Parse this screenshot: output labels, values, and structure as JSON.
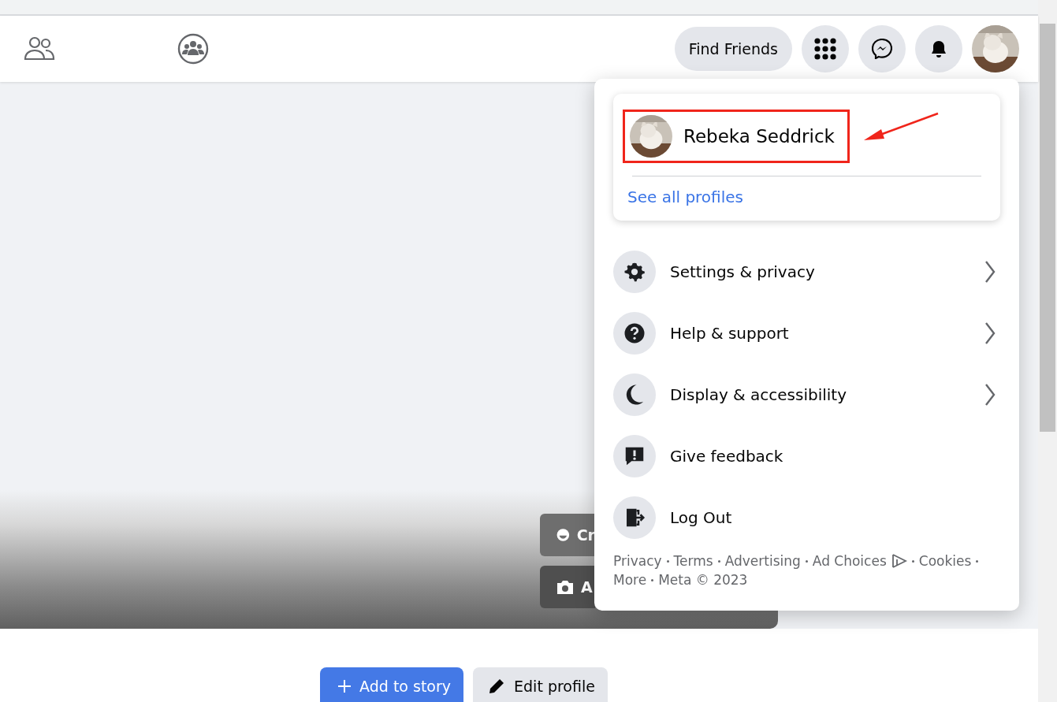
{
  "navbar": {
    "find_friends": "Find Friends"
  },
  "cover": {
    "buttons": [
      {
        "kind": "avatar",
        "label": "Cr"
      },
      {
        "kind": "camera",
        "label": "A"
      }
    ]
  },
  "profile_actions": [
    {
      "kind": "add",
      "label": "Add to story",
      "primary": true
    },
    {
      "kind": "edit",
      "label": "Edit profile",
      "primary": false
    }
  ],
  "account_menu": {
    "profile_name": "Rebeka Seddrick",
    "highlighted": true,
    "see_all": "See all profiles",
    "items": [
      {
        "kind": "gear",
        "label": "Settings & privacy",
        "submenu": true
      },
      {
        "kind": "help",
        "label": "Help & support",
        "submenu": true
      },
      {
        "kind": "moon",
        "label": "Display & accessibility",
        "submenu": true
      },
      {
        "kind": "feedback",
        "label": "Give feedback",
        "submenu": false
      },
      {
        "kind": "logout",
        "label": "Log Out",
        "submenu": false
      }
    ],
    "footer_links": [
      "Privacy",
      "Terms",
      "Advertising",
      "Ad Choices",
      "Cookies",
      "More",
      "Meta © 2023"
    ]
  }
}
